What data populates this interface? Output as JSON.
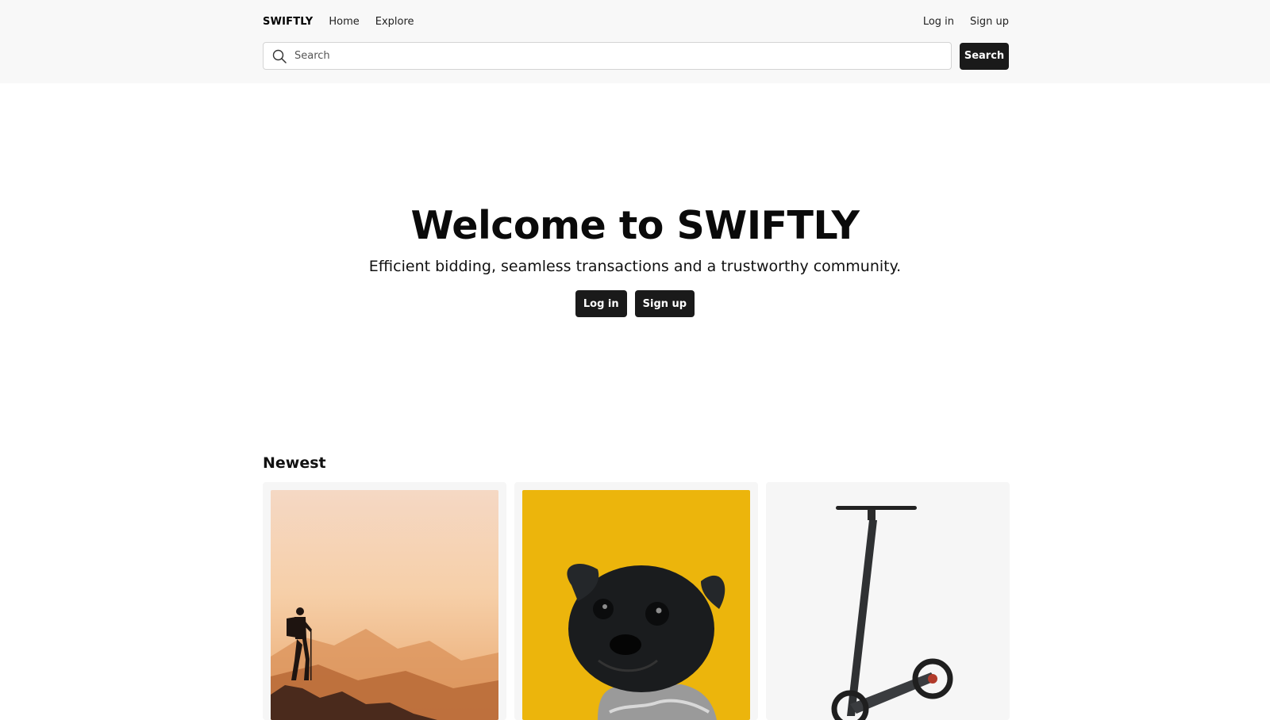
{
  "nav": {
    "brand": "SWIFTLY",
    "home": "Home",
    "explore": "Explore",
    "login": "Log in",
    "signup": "Sign up"
  },
  "search": {
    "placeholder": "Search",
    "button_label": "Search",
    "icon": "search-icon"
  },
  "hero": {
    "title": "Welcome to SWIFTLY",
    "subtitle": "Efficient bidding, seamless transactions and a trustworthy community.",
    "login": "Log in",
    "signup": "Sign up"
  },
  "newest": {
    "title": "Newest",
    "items": [
      {
        "image": "hiker-on-mountain-at-sunset"
      },
      {
        "image": "black-pug-on-yellow-background"
      },
      {
        "image": "electric-scooter"
      }
    ]
  },
  "colors": {
    "topbar_bg": "#f8f8f8",
    "button_bg": "#1a1a1a",
    "card_bg": "#f6f6f6",
    "pug_bg": "#ecb50c"
  }
}
